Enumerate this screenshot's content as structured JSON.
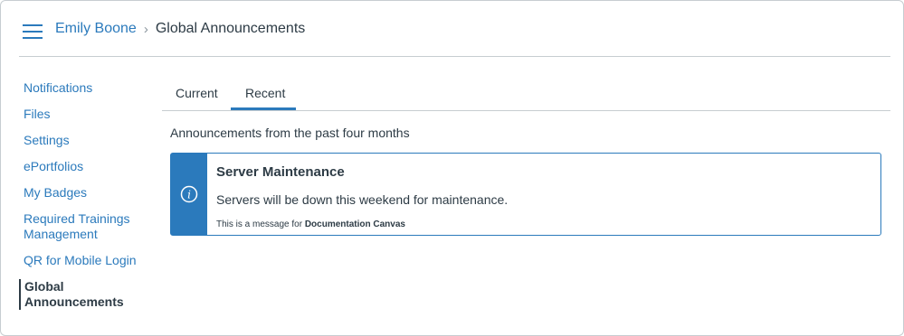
{
  "header": {
    "menu_icon": "hamburger-menu-icon",
    "breadcrumb": {
      "user": "Emily Boone",
      "separator": "›",
      "current": "Global Announcements"
    }
  },
  "sidebar": {
    "items": [
      {
        "label": "Notifications"
      },
      {
        "label": "Files"
      },
      {
        "label": "Settings"
      },
      {
        "label": "ePortfolios"
      },
      {
        "label": "My Badges"
      },
      {
        "label": "Required Trainings Management"
      },
      {
        "label": "QR for Mobile Login"
      },
      {
        "label": "Global Announcements",
        "active": true
      }
    ]
  },
  "tabs": [
    {
      "label": "Current"
    },
    {
      "label": "Recent",
      "active": true
    }
  ],
  "subtitle": "Announcements from the past four months",
  "announcement": {
    "icon": "info-icon",
    "title": "Server Maintenance",
    "message": "Servers will be down this weekend for maintenance.",
    "footer_prefix": "This is a message for",
    "footer_account": "Documentation Canvas"
  },
  "colors": {
    "accent": "#2b7abc",
    "text": "#2d3b45",
    "divider": "#c7cdd1"
  }
}
